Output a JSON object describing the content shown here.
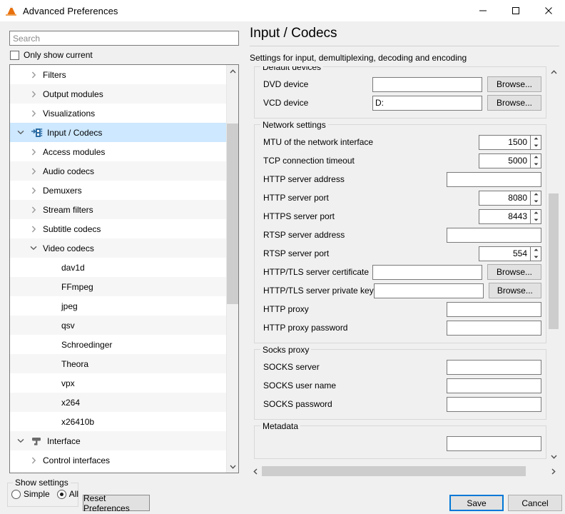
{
  "window": {
    "title": "Advanced Preferences",
    "icon": "vlc-cone-icon",
    "minimize_label": "─",
    "maximize_label": "□",
    "close_label": "✕"
  },
  "sidebar": {
    "search": {
      "placeholder": "Search",
      "value": ""
    },
    "only_show_current": {
      "label": "Only show current",
      "checked": false
    },
    "items": [
      {
        "label": "Filters",
        "depth": 1,
        "twisty": "right",
        "icon": null,
        "selected": false
      },
      {
        "label": "Output modules",
        "depth": 1,
        "twisty": "right",
        "icon": null,
        "selected": false
      },
      {
        "label": "Visualizations",
        "depth": 1,
        "twisty": "right",
        "icon": null,
        "selected": false
      },
      {
        "label": "Input / Codecs",
        "depth": 0,
        "twisty": "down",
        "icon": "film-strip-icon",
        "selected": true
      },
      {
        "label": "Access modules",
        "depth": 1,
        "twisty": "right",
        "icon": null,
        "selected": false
      },
      {
        "label": "Audio codecs",
        "depth": 1,
        "twisty": "right",
        "icon": null,
        "selected": false
      },
      {
        "label": "Demuxers",
        "depth": 1,
        "twisty": "right",
        "icon": null,
        "selected": false
      },
      {
        "label": "Stream filters",
        "depth": 1,
        "twisty": "right",
        "icon": null,
        "selected": false
      },
      {
        "label": "Subtitle codecs",
        "depth": 1,
        "twisty": "right",
        "icon": null,
        "selected": false
      },
      {
        "label": "Video codecs",
        "depth": 1,
        "twisty": "down",
        "icon": null,
        "selected": false
      },
      {
        "label": "dav1d",
        "depth": 2,
        "twisty": null,
        "icon": null,
        "selected": false
      },
      {
        "label": "FFmpeg",
        "depth": 2,
        "twisty": null,
        "icon": null,
        "selected": false
      },
      {
        "label": "jpeg",
        "depth": 2,
        "twisty": null,
        "icon": null,
        "selected": false
      },
      {
        "label": "qsv",
        "depth": 2,
        "twisty": null,
        "icon": null,
        "selected": false
      },
      {
        "label": "Schroedinger",
        "depth": 2,
        "twisty": null,
        "icon": null,
        "selected": false
      },
      {
        "label": "Theora",
        "depth": 2,
        "twisty": null,
        "icon": null,
        "selected": false
      },
      {
        "label": "vpx",
        "depth": 2,
        "twisty": null,
        "icon": null,
        "selected": false
      },
      {
        "label": "x264",
        "depth": 2,
        "twisty": null,
        "icon": null,
        "selected": false
      },
      {
        "label": "x26410b",
        "depth": 2,
        "twisty": null,
        "icon": null,
        "selected": false
      },
      {
        "label": "Interface",
        "depth": 0,
        "twisty": "down",
        "icon": "paint-roller-icon",
        "selected": false
      },
      {
        "label": "Control interfaces",
        "depth": 1,
        "twisty": "right",
        "icon": null,
        "selected": false
      }
    ]
  },
  "main": {
    "title": "Input / Codecs",
    "description": "Settings for input, demultiplexing, decoding and encoding",
    "groups": [
      {
        "title": "Default devices",
        "fields": [
          {
            "label": "DVD device",
            "kind": "text-browse",
            "value": "",
            "button": "Browse..."
          },
          {
            "label": "VCD device",
            "kind": "text-browse",
            "value": "D:",
            "button": "Browse..."
          }
        ]
      },
      {
        "title": "Network settings",
        "fields": [
          {
            "label": "MTU of the network interface",
            "kind": "spin",
            "value": "1500"
          },
          {
            "label": "TCP connection timeout",
            "kind": "spin",
            "value": "5000"
          },
          {
            "label": "HTTP server address",
            "kind": "text",
            "value": ""
          },
          {
            "label": "HTTP server port",
            "kind": "spin",
            "value": "8080"
          },
          {
            "label": "HTTPS server port",
            "kind": "spin",
            "value": "8443"
          },
          {
            "label": "RTSP server address",
            "kind": "text",
            "value": ""
          },
          {
            "label": "RTSP server port",
            "kind": "spin",
            "value": "554"
          },
          {
            "label": "HTTP/TLS server certificate",
            "kind": "text-browse",
            "value": "",
            "button": "Browse..."
          },
          {
            "label": "HTTP/TLS server private key",
            "kind": "text-browse",
            "value": "",
            "button": "Browse..."
          },
          {
            "label": "HTTP proxy",
            "kind": "text",
            "value": ""
          },
          {
            "label": "HTTP proxy password",
            "kind": "text",
            "value": ""
          }
        ]
      },
      {
        "title": "Socks proxy",
        "fields": [
          {
            "label": "SOCKS server",
            "kind": "text",
            "value": ""
          },
          {
            "label": "SOCKS user name",
            "kind": "text",
            "value": ""
          },
          {
            "label": "SOCKS password",
            "kind": "text",
            "value": ""
          }
        ]
      },
      {
        "title": "Metadata",
        "fields": [
          {
            "label": "",
            "kind": "text",
            "value": ""
          }
        ]
      }
    ]
  },
  "footer": {
    "show_settings": {
      "title": "Show settings",
      "options": [
        {
          "label": "Simple",
          "selected": false
        },
        {
          "label": "All",
          "selected": true
        }
      ]
    },
    "reset_label": "Reset Preferences",
    "save_label": "Save",
    "cancel_label": "Cancel"
  },
  "colors": {
    "selection": "#cde8ff",
    "accent": "#0078d7",
    "chrome": "#f0f0f0",
    "scroll_thumb": "#cdcdcd"
  }
}
